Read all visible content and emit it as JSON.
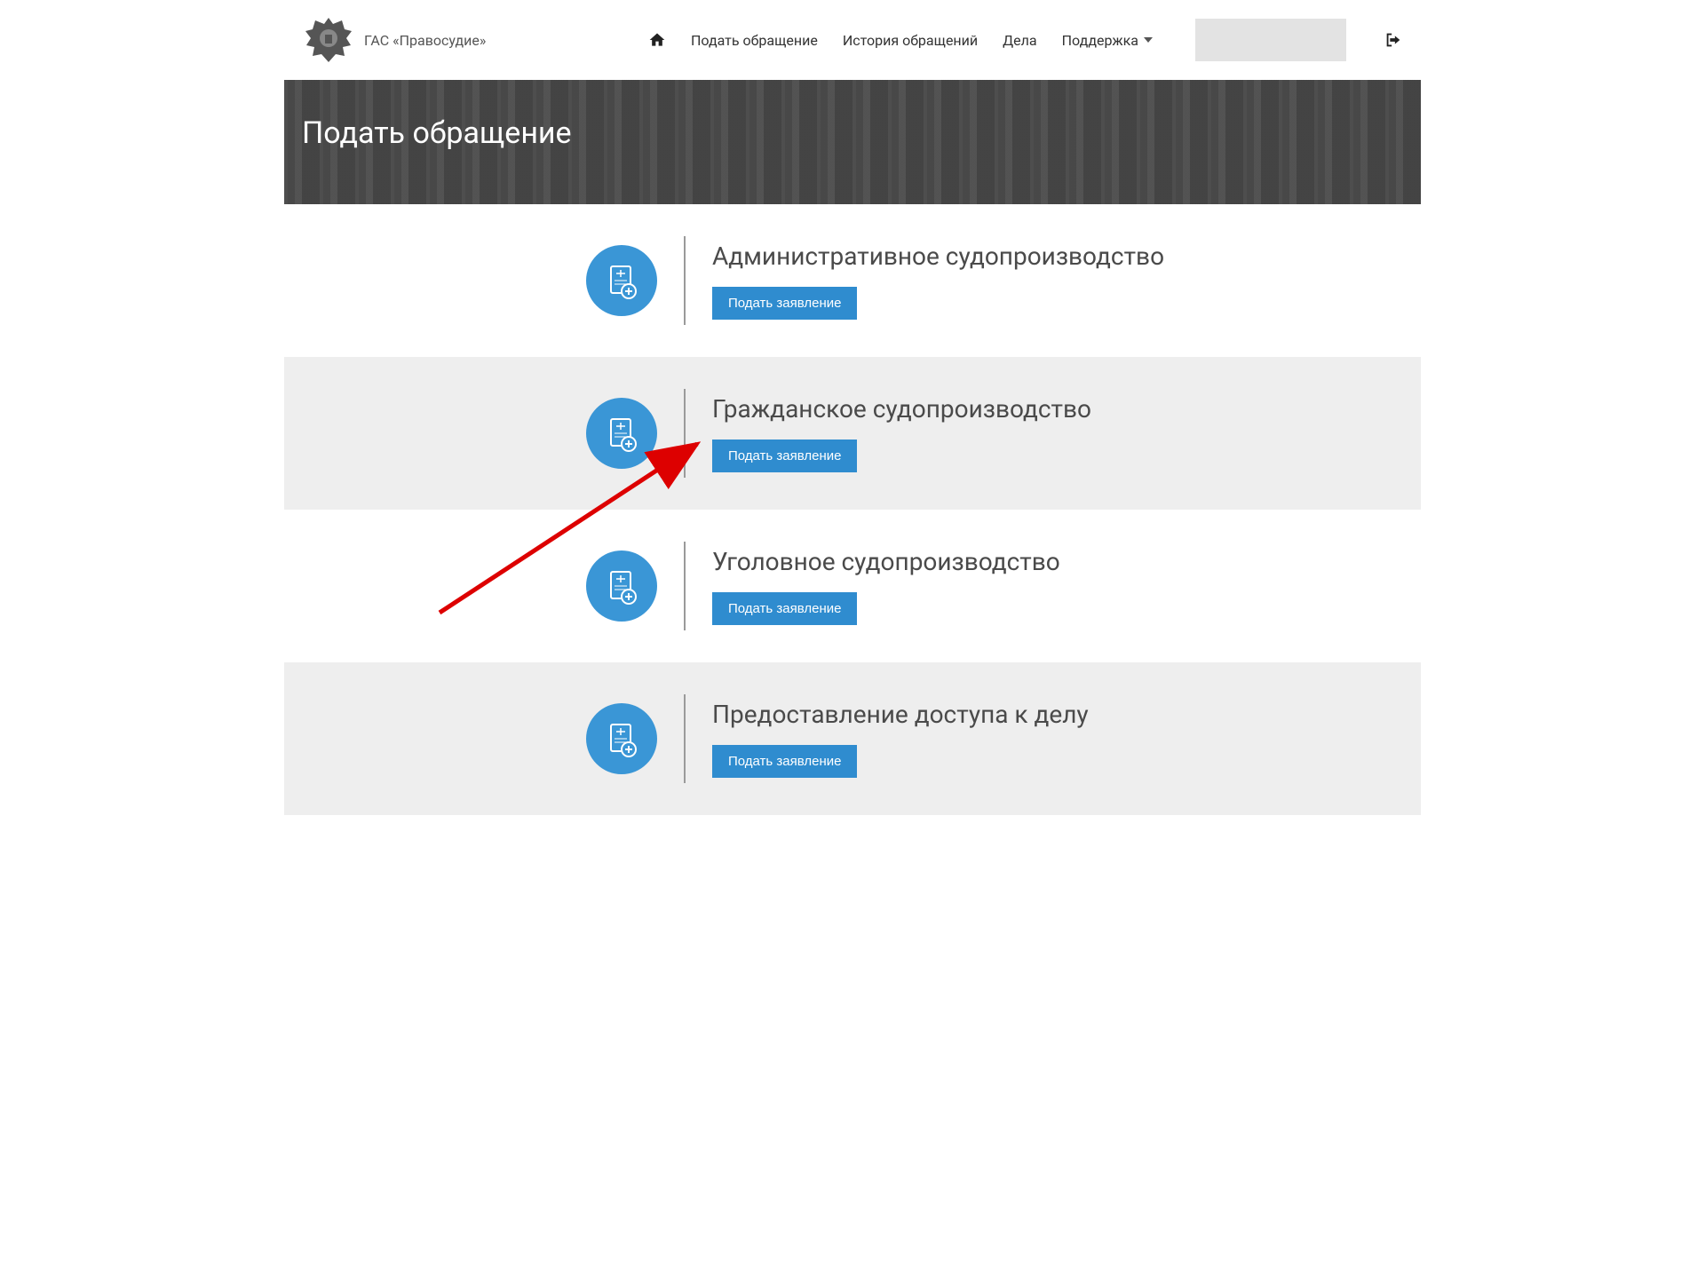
{
  "brand": {
    "name": "ГАС «Правосудие»"
  },
  "nav": {
    "submit": "Подать обращение",
    "history": "История обращений",
    "cases": "Дела",
    "support": "Поддержка"
  },
  "hero": {
    "title": "Подать обращение"
  },
  "button_label": "Подать заявление",
  "sections": [
    {
      "title": "Административное судопроизводство"
    },
    {
      "title": "Гражданское судопроизводство"
    },
    {
      "title": "Уголовное судопроизводство"
    },
    {
      "title": "Предоставление доступа к делу"
    }
  ]
}
